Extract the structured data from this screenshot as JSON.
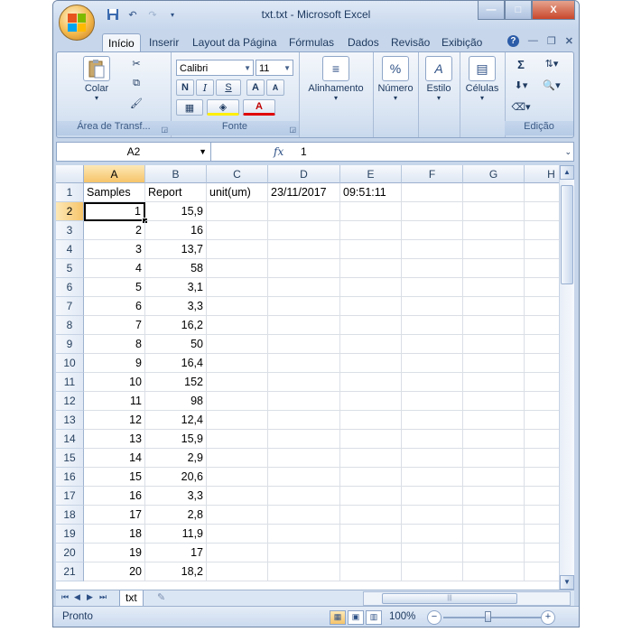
{
  "window": {
    "title": "txt.txt - Microsoft Excel",
    "controls": {
      "minimize": "—",
      "maximize": "□",
      "close": "X"
    }
  },
  "qat": {
    "save_icon": "save-icon",
    "undo_icon": "undo-icon",
    "redo_icon": "redo-icon"
  },
  "tabs": [
    "Início",
    "Inserir",
    "Layout da Página",
    "Fórmulas",
    "Dados",
    "Revisão",
    "Exibição"
  ],
  "ribbon": {
    "clipboard": {
      "paste_label": "Colar",
      "group_label": "Área de Transf..."
    },
    "font": {
      "font_name": "Calibri",
      "font_size": "11",
      "bold": "N",
      "italic": "I",
      "underline": "S",
      "grow": "A",
      "shrink": "A",
      "group_label": "Fonte"
    },
    "alignment": {
      "label": "Alinhamento"
    },
    "number": {
      "label": "Número",
      "icon_glyph": "%"
    },
    "style": {
      "label": "Estilo",
      "icon_glyph": "A"
    },
    "cells": {
      "label": "Células"
    },
    "editing": {
      "group_label": "Edição",
      "sum_glyph": "Σ"
    }
  },
  "formula_bar": {
    "name_box": "A2",
    "fx": "fx",
    "value": "1"
  },
  "grid": {
    "columns": [
      "A",
      "B",
      "C",
      "D",
      "E",
      "F",
      "G",
      "H"
    ],
    "selected_column": "A",
    "selected_row": "2",
    "rows": [
      {
        "n": "1",
        "cells": [
          "Samples",
          "Report",
          "unit(um)",
          "23/11/2017",
          "09:51:11"
        ]
      },
      {
        "n": "2",
        "cells": [
          "1",
          "15,9"
        ]
      },
      {
        "n": "3",
        "cells": [
          "2",
          "16"
        ]
      },
      {
        "n": "4",
        "cells": [
          "3",
          "13,7"
        ]
      },
      {
        "n": "5",
        "cells": [
          "4",
          "58"
        ]
      },
      {
        "n": "6",
        "cells": [
          "5",
          "3,1"
        ]
      },
      {
        "n": "7",
        "cells": [
          "6",
          "3,3"
        ]
      },
      {
        "n": "8",
        "cells": [
          "7",
          "16,2"
        ]
      },
      {
        "n": "9",
        "cells": [
          "8",
          "50"
        ]
      },
      {
        "n": "10",
        "cells": [
          "9",
          "16,4"
        ]
      },
      {
        "n": "11",
        "cells": [
          "10",
          "152"
        ]
      },
      {
        "n": "12",
        "cells": [
          "11",
          "98"
        ]
      },
      {
        "n": "13",
        "cells": [
          "12",
          "12,4"
        ]
      },
      {
        "n": "14",
        "cells": [
          "13",
          "15,9"
        ]
      },
      {
        "n": "15",
        "cells": [
          "14",
          "2,9"
        ]
      },
      {
        "n": "16",
        "cells": [
          "15",
          "20,6"
        ]
      },
      {
        "n": "17",
        "cells": [
          "16",
          "3,3"
        ]
      },
      {
        "n": "18",
        "cells": [
          "17",
          "2,8"
        ]
      },
      {
        "n": "19",
        "cells": [
          "18",
          "11,9"
        ]
      },
      {
        "n": "20",
        "cells": [
          "19",
          "17"
        ]
      },
      {
        "n": "21",
        "cells": [
          "20",
          "18,2"
        ]
      }
    ]
  },
  "sheet_tabs": {
    "active": "txt"
  },
  "status": {
    "text": "Pronto",
    "zoom": "100%"
  }
}
